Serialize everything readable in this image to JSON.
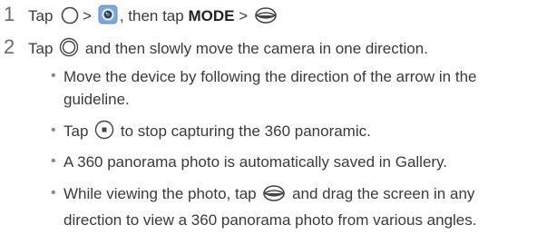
{
  "steps": [
    {
      "number": "1",
      "parts": {
        "t1": "Tap",
        "t2": ">",
        "t3": ", then tap",
        "mode": "MODE",
        "t4": ">"
      },
      "icons": [
        "circle-outline-icon",
        "camera-app-icon",
        "panorama-360-icon"
      ]
    },
    {
      "number": "2",
      "parts": {
        "t1": "Tap",
        "t2": "and then slowly move the camera in one direction."
      },
      "icons": [
        "shutter-button-icon"
      ]
    }
  ],
  "bullets": [
    {
      "text": "Move the device by following the direction of the arrow in the guideline."
    },
    {
      "t1": "Tap",
      "t2": "to stop capturing the 360 panoramic.",
      "icons": [
        "stop-button-icon"
      ]
    },
    {
      "text": "A 360 panorama photo is automatically saved in Gallery."
    },
    {
      "t1": "While viewing the photo, tap",
      "t2": "and drag the screen in any direction to view a 360 panorama photo from various angles.",
      "icons": [
        "panorama-360-icon"
      ]
    }
  ],
  "colors": {
    "text": "#3a3a3a",
    "step_number": "#6b6b6b",
    "camera_icon": "#5b8fc7"
  }
}
